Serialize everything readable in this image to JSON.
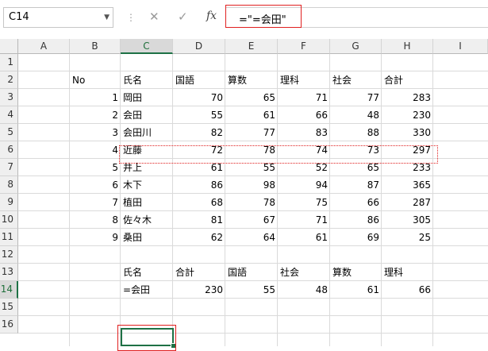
{
  "formula_bar": {
    "name_box": "C14",
    "formula": "=\"=会田\"",
    "cancel_icon": "close-icon",
    "enter_icon": "check-icon",
    "fx_label": "fx"
  },
  "columns": [
    "A",
    "B",
    "C",
    "D",
    "E",
    "F",
    "G",
    "H",
    "I"
  ],
  "rows": [
    "1",
    "2",
    "3",
    "4",
    "5",
    "6",
    "7",
    "8",
    "9",
    "10",
    "11",
    "12",
    "13",
    "14",
    "15",
    "16"
  ],
  "table1": {
    "headers": [
      "No",
      "氏名",
      "国語",
      "算数",
      "理科",
      "社会",
      "合計"
    ],
    "data": [
      [
        "1",
        "岡田",
        "70",
        "65",
        "71",
        "77",
        "283"
      ],
      [
        "2",
        "会田",
        "55",
        "61",
        "66",
        "48",
        "230"
      ],
      [
        "3",
        "会田川",
        "82",
        "77",
        "83",
        "88",
        "330"
      ],
      [
        "4",
        "近藤",
        "72",
        "78",
        "74",
        "73",
        "297"
      ],
      [
        "5",
        "井上",
        "61",
        "55",
        "52",
        "65",
        "233"
      ],
      [
        "6",
        "木下",
        "86",
        "98",
        "94",
        "87",
        "365"
      ],
      [
        "7",
        "植田",
        "68",
        "78",
        "75",
        "66",
        "287"
      ],
      [
        "8",
        "佐々木",
        "81",
        "67",
        "71",
        "86",
        "305"
      ],
      [
        "9",
        "桑田",
        "62",
        "64",
        "61",
        "69",
        "25"
      ]
    ]
  },
  "table2": {
    "headers": [
      "氏名",
      "合計",
      "国語",
      "社会",
      "算数",
      "理科"
    ],
    "values": [
      "=会田",
      "230",
      "55",
      "48",
      "61",
      "66"
    ]
  },
  "active_cell": "C14",
  "colors": {
    "highlight": "#e02020",
    "selection": "#1e7145"
  }
}
